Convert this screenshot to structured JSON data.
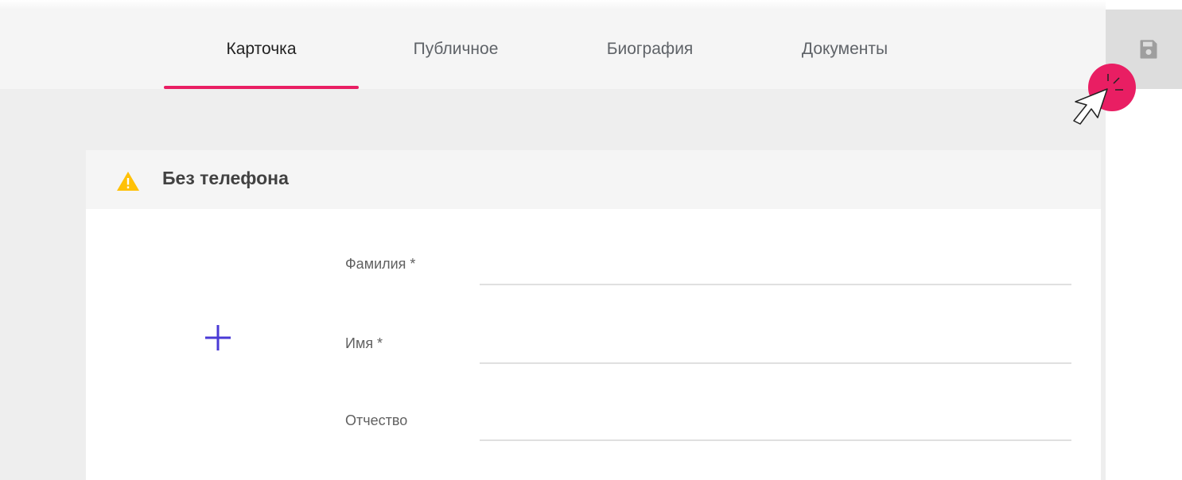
{
  "tabs": [
    {
      "label": "Карточка",
      "active": true
    },
    {
      "label": "Публичное",
      "active": false
    },
    {
      "label": "Биография",
      "active": false
    },
    {
      "label": "Документы",
      "active": false
    }
  ],
  "card": {
    "title": "Без телефона",
    "warning_icon": "warning-triangle-icon",
    "add_icon": "plus-icon"
  },
  "form": {
    "fields": [
      {
        "label": "Фамилия *",
        "value": ""
      },
      {
        "label": "Имя *",
        "value": ""
      },
      {
        "label": "Отчество",
        "value": ""
      }
    ]
  },
  "toolbar": {
    "save_icon": "save-icon"
  },
  "colors": {
    "accent": "#e91e63",
    "warning": "#ffc107",
    "add_icon": "#4a3ad6",
    "tab_bar": "#f5f5f5",
    "page_bg": "#eeeeee"
  }
}
